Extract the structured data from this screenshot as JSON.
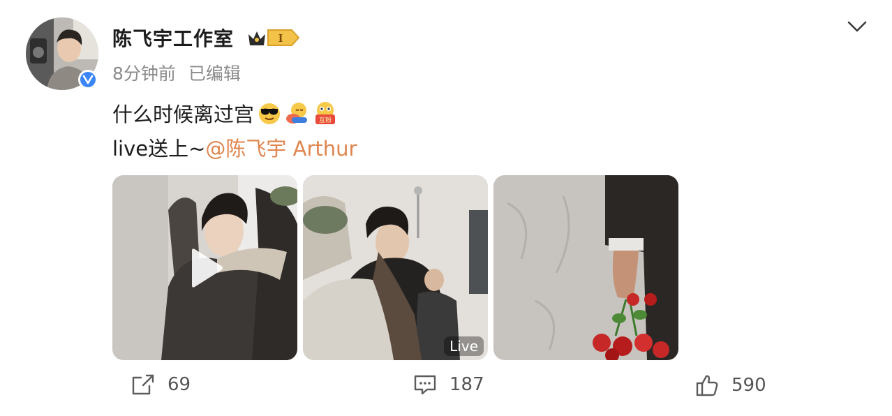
{
  "header": {
    "account_name": "陈飞宇工作室",
    "member_badge": "I",
    "time": "8分钟前",
    "edited": "已编辑"
  },
  "post": {
    "line1_text": "什么时候离过宫",
    "emojis": [
      "sunglasses-emoji",
      "hug-emoji",
      "mutual-fans-emoji"
    ],
    "emoji_badge_text": "互粉",
    "line2_prefix": "live送上~",
    "mention": "@陈飞宇 Arthur",
    "media": [
      {
        "type": "video",
        "label": ""
      },
      {
        "type": "live",
        "label": "Live"
      },
      {
        "type": "image",
        "label": ""
      }
    ]
  },
  "actions": {
    "repost_count": "69",
    "comment_count": "187",
    "like_count": "590"
  },
  "icons": {
    "repost": "share-icon",
    "comment": "comment-icon",
    "like": "thumbs-up-icon",
    "menu": "chevron-down-icon"
  },
  "colors": {
    "mention": "#e0854e",
    "verified": "#3b86f6",
    "badge_gold": "#f3c349"
  }
}
